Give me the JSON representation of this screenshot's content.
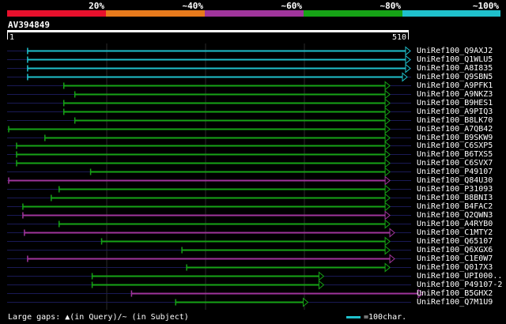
{
  "legend": {
    "segments": [
      {
        "label": "20%",
        "color": "#e8102c"
      },
      {
        "label": "~40%",
        "color": "#e87a1c"
      },
      {
        "label": "~60%",
        "color": "#a0359c"
      },
      {
        "label": "~80%",
        "color": "#16a316"
      },
      {
        "label": "~100%",
        "color": "#1fc0cc"
      }
    ]
  },
  "query": {
    "name": "AV394849",
    "start_label": "1",
    "end_label": "510",
    "length": 510
  },
  "colors": {
    "cyan": "#1fc0cc",
    "green": "#16a316",
    "purple": "#a0359c",
    "dark_line": "#1a1a55",
    "gap_mark": "#cfe8ff"
  },
  "hits": [
    {
      "name": "UniRef100_Q9AXJ2",
      "start": 26,
      "end": 512,
      "color": "cyan"
    },
    {
      "name": "UniRef100_Q1WLU5",
      "start": 26,
      "end": 512,
      "color": "cyan"
    },
    {
      "name": "UniRef100_A8I835",
      "start": 26,
      "end": 512,
      "color": "cyan"
    },
    {
      "name": "UniRef100_Q9SBN5",
      "start": 26,
      "end": 508,
      "color": "cyan"
    },
    {
      "name": "UniRef100_A9PFK1",
      "start": 72,
      "end": 486,
      "color": "green"
    },
    {
      "name": "UniRef100_A9NKZ3",
      "start": 86,
      "end": 486,
      "color": "green"
    },
    {
      "name": "UniRef100_B9HES1",
      "start": 72,
      "end": 486,
      "color": "green"
    },
    {
      "name": "UniRef100_A9PIQ3",
      "start": 72,
      "end": 486,
      "color": "green"
    },
    {
      "name": "UniRef100_B8LK70",
      "start": 86,
      "end": 486,
      "color": "green"
    },
    {
      "name": "UniRef100_A7QB42",
      "start": 2,
      "end": 486,
      "color": "green"
    },
    {
      "name": "UniRef100_B9SKW9",
      "start": 48,
      "end": 486,
      "color": "green"
    },
    {
      "name": "UniRef100_C6SXP5",
      "start": 12,
      "end": 486,
      "color": "green"
    },
    {
      "name": "UniRef100_B6TXS5",
      "start": 12,
      "end": 486,
      "color": "green"
    },
    {
      "name": "UniRef100_C6SVX7",
      "start": 12,
      "end": 486,
      "color": "green"
    },
    {
      "name": "UniRef100_P49107",
      "start": 106,
      "end": 486,
      "color": "green"
    },
    {
      "name": "UniRef100_Q84U30",
      "start": 2,
      "end": 486,
      "color": "purple"
    },
    {
      "name": "UniRef100_P31093",
      "start": 66,
      "end": 486,
      "color": "green"
    },
    {
      "name": "UniRef100_B8BNI3",
      "start": 56,
      "end": 486,
      "color": "green"
    },
    {
      "name": "UniRef100_B4FAC2",
      "start": 20,
      "end": 486,
      "color": "green"
    },
    {
      "name": "UniRef100_Q2QWN3",
      "start": 20,
      "end": 486,
      "color": "purple"
    },
    {
      "name": "UniRef100_A4RYB0",
      "start": 66,
      "end": 486,
      "color": "green"
    },
    {
      "name": "UniRef100_C1MTY2",
      "start": 22,
      "end": 492,
      "color": "purple"
    },
    {
      "name": "UniRef100_Q65107",
      "start": 120,
      "end": 486,
      "color": "green"
    },
    {
      "name": "UniRef100_Q6XGX6",
      "start": 222,
      "end": 486,
      "color": "green"
    },
    {
      "name": "UniRef100_C1E0W7",
      "start": 26,
      "end": 492,
      "color": "purple"
    },
    {
      "name": "UniRef100_Q017X3",
      "start": 228,
      "end": 486,
      "color": "green"
    },
    {
      "name": "UniRef100_UPI000..",
      "start": 108,
      "end": 402,
      "color": "green"
    },
    {
      "name": "UniRef100_P49107-2",
      "start": 108,
      "end": 402,
      "color": "green"
    },
    {
      "name": "UniRef100_B5GHX2",
      "start": 158,
      "end": 528,
      "color": "purple"
    },
    {
      "name": "UniRef100_Q7M1U9",
      "start": 214,
      "end": 382,
      "color": "green"
    }
  ],
  "footer": {
    "text": "Large gaps: ▲(in Query)/~ (in Subject)",
    "scale_label": "=100char."
  }
}
